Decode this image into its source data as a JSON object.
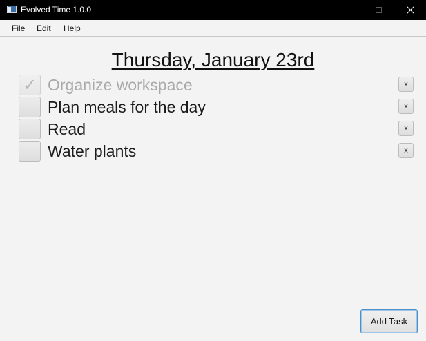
{
  "window": {
    "title": "Evolved Time 1.0.0"
  },
  "menu": {
    "items": [
      "File",
      "Edit",
      "Help"
    ]
  },
  "date_heading": "Thursday, January 23rd",
  "tasks": [
    {
      "label": "Organize workspace",
      "checked": true,
      "remove_label": "x"
    },
    {
      "label": "Plan meals for the day",
      "checked": false,
      "remove_label": "x"
    },
    {
      "label": "Read",
      "checked": false,
      "remove_label": "x"
    },
    {
      "label": "Water plants",
      "checked": false,
      "remove_label": "x"
    }
  ],
  "add_task_label": "Add Task",
  "icons": {
    "app": "app-window-icon",
    "check": "checkmark-icon"
  },
  "colors": {
    "titlebar_bg": "#000000",
    "content_bg": "#f3f3f3",
    "done_text": "#a9a9a9",
    "focus_border": "#4a8fc7"
  }
}
